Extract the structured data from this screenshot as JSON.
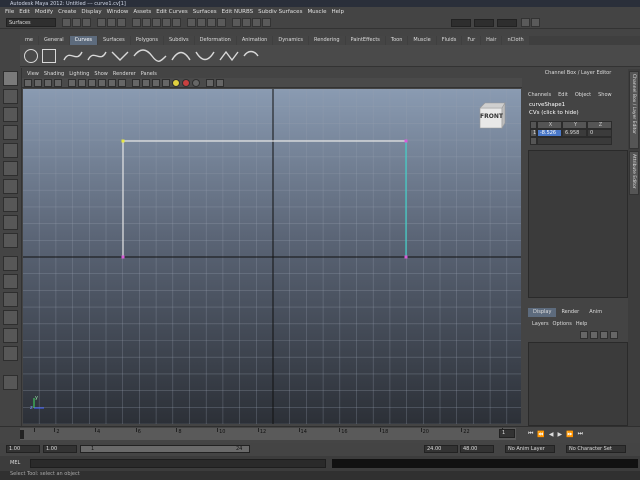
{
  "app": {
    "title": "Autodesk Maya 2012: Untitled  ---  curve1.cv[1]"
  },
  "menubar": [
    "File",
    "Edit",
    "Modify",
    "Create",
    "Display",
    "Window",
    "Assets",
    "Edit Curves",
    "Surfaces",
    "Edit NURBS",
    "Subdiv Surfaces",
    "Muscle",
    "Help"
  ],
  "statusline": {
    "menuset": "Surfaces"
  },
  "shelf": {
    "tabs": [
      "me",
      "General",
      "Curves",
      "Surfaces",
      "Polygons",
      "Subdivs",
      "Deformation",
      "Animation",
      "Dynamics",
      "Rendering",
      "PaintEffects",
      "Toon",
      "Muscle",
      "Fluids",
      "Fur",
      "Hair",
      "nCloth"
    ],
    "active_tab": "Curves"
  },
  "viewport": {
    "menu": [
      "View",
      "Shading",
      "Lighting",
      "Show",
      "Renderer",
      "Panels"
    ],
    "cube_label": "FRONT",
    "axis_y": "y",
    "axis_z": "z"
  },
  "channel_box": {
    "title": "Channel Box / Layer Editor",
    "menu": [
      "Channels",
      "Edit",
      "Object",
      "Show"
    ],
    "object": "curveShape1",
    "cvs_label": "CVs (click to hide)",
    "columns": [
      "X",
      "Y",
      "Z"
    ],
    "row_index": "1",
    "values": {
      "x": "-8.526",
      "y": "6.958",
      "z": "0"
    }
  },
  "side_tabs": [
    "Channel Box / Layer Editor",
    "Attribute Editor"
  ],
  "layer_editor": {
    "tabs": [
      "Display",
      "Render",
      "Anim"
    ],
    "active_tab": "Display",
    "menu": [
      "Layers",
      "Options",
      "Help"
    ]
  },
  "timeline": {
    "ticks": [
      "1",
      "2",
      "4",
      "6",
      "8",
      "10",
      "12",
      "14",
      "16",
      "18",
      "20",
      "22",
      "24"
    ],
    "current_frame": "1"
  },
  "range": {
    "start": "1.00",
    "playback_start": "1.00",
    "slider_start": "1",
    "slider_end": "24",
    "playback_end": "24.00",
    "end": "48.00",
    "anim_layer": "No Anim Layer",
    "character_set": "No Character Set"
  },
  "command_line": {
    "label": "MEL"
  },
  "help_line": "Select Tool: select an object",
  "colors": {
    "accent": "#5d6b7d",
    "curve": "#e6e6e6",
    "curve_edge": "#3fd0c8",
    "cv_vertex": "#d95bd9"
  }
}
